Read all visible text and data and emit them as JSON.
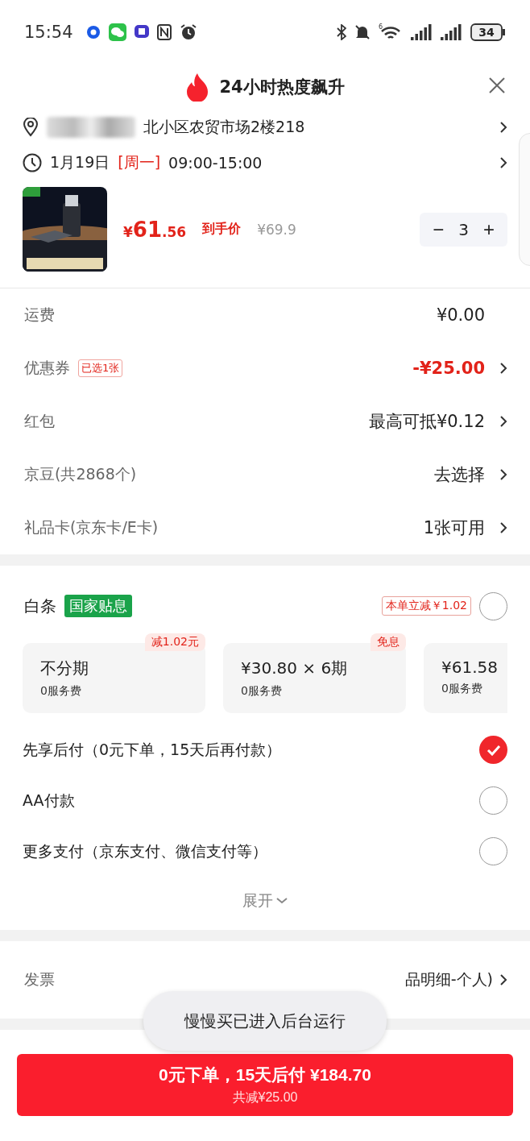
{
  "status_bar": {
    "time": "15:54",
    "network_badge": "6",
    "battery": "34"
  },
  "header": {
    "title": "24小时热度飙升"
  },
  "address": {
    "text": "北小区农贸市场2楼218"
  },
  "delivery": {
    "date": "1月19日",
    "weekday": "[周一]",
    "time": "09:00-15:00"
  },
  "product": {
    "kind": "picture",
    "currency": "¥",
    "price_int": "61",
    "price_dec": ".56",
    "price_label": "到手价",
    "original_price": "¥69.9",
    "quantity": "3",
    "minus": "−",
    "plus": "+"
  },
  "fee_rows": [
    {
      "label": "运费",
      "value": "¥0.00",
      "highlight": false,
      "arrow": false
    },
    {
      "label": "优惠券",
      "tag": "已选1张",
      "value": "-¥25.00",
      "highlight": true,
      "arrow": true
    },
    {
      "label": "红包",
      "value": "最高可抵¥0.12",
      "highlight": false,
      "arrow": true
    },
    {
      "label": "京豆(共2868个)",
      "value": "去选择",
      "highlight": false,
      "arrow": true
    },
    {
      "label": "礼品卡(京东卡/E卡)",
      "value": "1张可用",
      "highlight": false,
      "arrow": true
    }
  ],
  "baitiao": {
    "label": "白条",
    "badge": "国家贴息",
    "discount": "本单立减￥1.02",
    "selected": false,
    "plans": [
      {
        "title": "不分期",
        "fee": "0服务费",
        "tag": "减1.02元"
      },
      {
        "title": "¥30.80 × 6期",
        "fee": "0服务费",
        "tag": "免息"
      },
      {
        "title": "¥61.58",
        "fee": "0服务费"
      }
    ]
  },
  "payment_options": [
    {
      "label": "先享后付（0元下单，15天后再付款）",
      "selected": true
    },
    {
      "label": "AA付款",
      "selected": false
    },
    {
      "label": "更多支付（京东支付、微信支付等）",
      "selected": false
    }
  ],
  "expand": {
    "label": "展开"
  },
  "invoice": {
    "label": "发票",
    "value": "品明细-个人)"
  },
  "toast": {
    "text": "慢慢买已进入后台运行"
  },
  "submit": {
    "title": "0元下单，15天后付 ¥184.70",
    "subtitle": "共减¥25.00"
  }
}
